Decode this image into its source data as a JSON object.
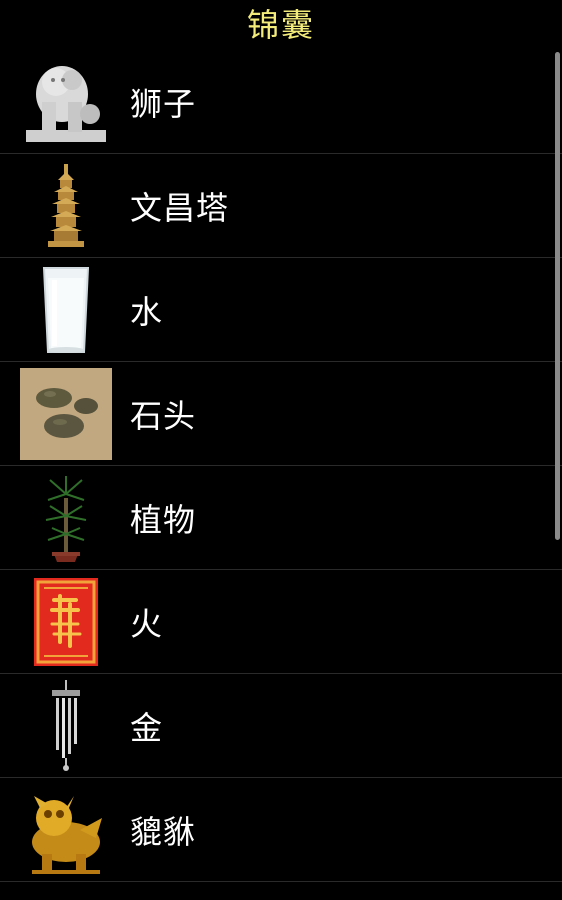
{
  "header": {
    "title": "锦囊"
  },
  "items": [
    {
      "label": "狮子",
      "icon": "stone-lion-icon"
    },
    {
      "label": "文昌塔",
      "icon": "pagoda-icon"
    },
    {
      "label": "水",
      "icon": "water-glass-icon"
    },
    {
      "label": "石头",
      "icon": "stones-icon"
    },
    {
      "label": "植物",
      "icon": "potted-plant-icon"
    },
    {
      "label": "火",
      "icon": "red-fortune-card-icon"
    },
    {
      "label": "金",
      "icon": "wind-chime-icon"
    },
    {
      "label": "貔貅",
      "icon": "golden-pixiu-icon"
    }
  ],
  "colors": {
    "title": "#f3ec7a",
    "text": "#ffffff",
    "background": "#000000",
    "divider": "#2a2a2a"
  }
}
